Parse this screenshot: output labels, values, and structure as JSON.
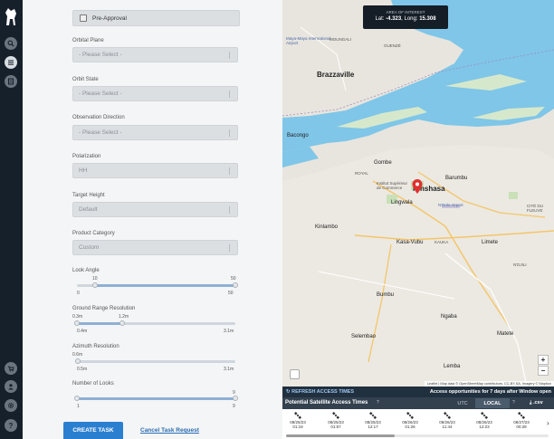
{
  "sidebar": {
    "icons": [
      "logo-icon",
      "search-icon",
      "list-icon",
      "layers-icon",
      "cart-icon",
      "user-icon",
      "settings-icon",
      "help-icon"
    ]
  },
  "form": {
    "preapproval_label": "Pre-Approval",
    "orbital_plane": {
      "label": "Orbital Plane",
      "value": "- Please Select -"
    },
    "orbit_state": {
      "label": "Orbit State",
      "value": "- Please Select -"
    },
    "observation_direction": {
      "label": "Observation Direction",
      "value": "- Please Select -"
    },
    "polarization": {
      "label": "Polarization",
      "value": "HH"
    },
    "target_height": {
      "label": "Target Height",
      "value": "Default"
    },
    "product_category": {
      "label": "Product Category",
      "value": "Custom"
    },
    "look_angle": {
      "label": "Look Angle",
      "low": "10",
      "high": "50",
      "min": "0",
      "max": "50",
      "range": [
        10,
        50
      ]
    },
    "ground_range": {
      "label": "Ground Range Resolution",
      "low": "0.3m",
      "high": "1.2m",
      "min": "0.4m",
      "max": "3.1m",
      "range": [
        0.3,
        1.2
      ]
    },
    "azimuth": {
      "label": "Azimuth Resolution",
      "low": "0.6m",
      "min": "0.5m",
      "max": "3.1m",
      "value": 0.6
    },
    "looks": {
      "label": "Number of Looks",
      "high": "9",
      "min": "1",
      "max": "9",
      "range": [
        1,
        9
      ]
    },
    "create_label": "CREATE TASK",
    "cancel_label": "Cancel Task Request"
  },
  "map": {
    "aoi_title": "AREA OF INTEREST",
    "aoi_lat_label": "Lat:",
    "aoi_lat": "-4.323",
    "aoi_long_label": ", Long:",
    "aoi_long": "15.308",
    "zoom_in": "+",
    "zoom_out": "−",
    "attribution": "Leaflet | Map data © OpenStreetMap contributors, CC-BY-SA, Imagery © Mapbox",
    "labels": {
      "brazzaville": "Brazzaville",
      "kinshasa": "Kinshasa",
      "bacongo": "Bacongo",
      "gombe": "Gombe",
      "barumbu": "Barumbu",
      "lingwala": "Lingwala",
      "kinlambo": "Kinlambo",
      "kasavubu": "Kasa-Vubu",
      "bumbu": "Bumbu",
      "ngaba": "Ngaba",
      "selembao": "Selembao",
      "lemba": "Lemba",
      "matete": "Matete",
      "limete": "Limete",
      "mayamaya": "Maya-Maya International Airport",
      "ndolo": "N'Dolo Airport",
      "moungali": "MOUNGALI",
      "ouenze": "OUENZÉ",
      "royal": "ROYAL",
      "institut": "Institut Supérieur de Commerce",
      "kauka": "KAUKA",
      "citedu": "CITÉ DU FLEUVE",
      "ndjili": "N'DJILI"
    }
  },
  "access": {
    "refresh_label": "REFRESH ACCESS TIMES",
    "note": "Access opportunities for 7 days after Window open",
    "title": "Potential Satellite Access Times",
    "help": "?",
    "utc": "UTC",
    "local": "LOCAL",
    "csv": "⤓ .csv",
    "times": [
      {
        "date": "08/25/23",
        "time": "01:19"
      },
      {
        "date": "08/25/23",
        "time": "01:57"
      },
      {
        "date": "08/25/23",
        "time": "12:17"
      },
      {
        "date": "08/26/23",
        "time": "01:26"
      },
      {
        "date": "08/26/23",
        "time": "11:44"
      },
      {
        "date": "08/26/23",
        "time": "12:23"
      },
      {
        "date": "08/27/23",
        "time": "00:28"
      }
    ]
  },
  "colors": {
    "accent": "#2b7fd0",
    "rail": "#16202b",
    "water": "#7fc6e8",
    "marker": "#e03030"
  }
}
